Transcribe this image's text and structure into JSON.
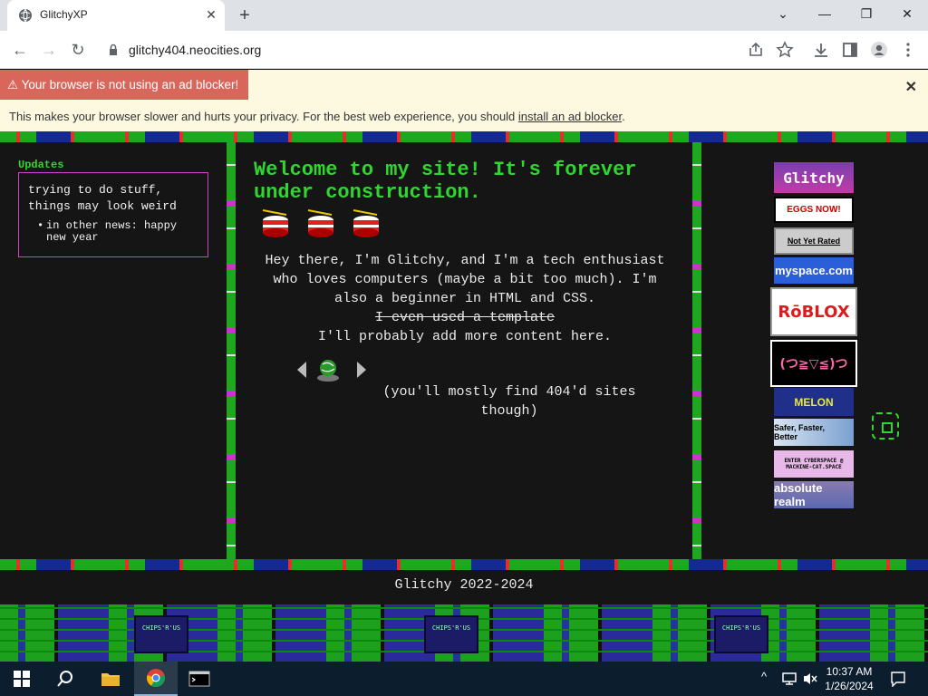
{
  "browser": {
    "tab_title": "GlitchyXP",
    "url": "glitchy404.neocities.org",
    "new_tab_symbol": "+",
    "tab_close_symbol": "✕"
  },
  "ad_banner": {
    "warning": "⚠ Your browser is not using an ad blocker!",
    "message_prefix": "This makes your browser slower and hurts your privacy. For the best web experience, you should ",
    "link_text": "install an ad blocker",
    "message_suffix": ".",
    "close_symbol": "✕"
  },
  "updates": {
    "title": "Updates",
    "main_text": "trying to do stuff, things may look weird",
    "items": [
      "in other news: happy new year"
    ]
  },
  "main": {
    "welcome": "Welcome to my site! It's forever under construction.",
    "intro_line1": "Hey there, I'm Glitchy, and I'm a tech enthusiast who loves computers (maybe a bit too much). I'm also a beginner in HTML and CSS.",
    "strike_text": "I even used a template",
    "intro_line2": "I'll probably add more content here.",
    "webring_note": "(you'll mostly find 404'd sites though)"
  },
  "badges": [
    {
      "label": "Glitchy",
      "icon": "glitchy-badge"
    },
    {
      "label": "EGGS NOW!",
      "icon": "eggs-badge"
    },
    {
      "label": "Not Yet Rated",
      "icon": "not-yet-rated-badge"
    },
    {
      "label": "myspace.com",
      "icon": "myspace-badge"
    },
    {
      "label": "RōBLOX",
      "icon": "roblox-badge"
    },
    {
      "label": "(つ≧▽≦)つ",
      "icon": "kaomoji-badge"
    },
    {
      "label": "MELON",
      "icon": "melon-badge"
    },
    {
      "label": "Safer, Faster, Better",
      "icon": "firefox-badge"
    },
    {
      "label": "ENTER CYBERSPACE @ MACHINE-CAT.SPACE",
      "icon": "cyberspace-badge"
    },
    {
      "label": "absolute realm",
      "icon": "absolute-realm-badge"
    }
  ],
  "chip_text": "CHIPS'R'US",
  "footer": "Glitchy 2022-2024",
  "taskbar": {
    "time": "10:37 AM",
    "date": "1/26/2024"
  },
  "colors": {
    "accent_green": "#2fd62f",
    "banner_red": "#d9665b",
    "box_border": "#cc44cc"
  }
}
